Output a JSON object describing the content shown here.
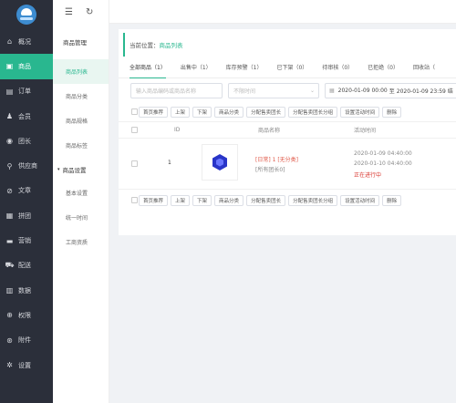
{
  "brand": {
    "logo_text": "魔云"
  },
  "sidebar": {
    "items": [
      {
        "label": "概况",
        "icon": "home-icon",
        "glyph": "⌂"
      },
      {
        "label": "商品",
        "icon": "goods-icon",
        "glyph": "▣",
        "active": true
      },
      {
        "label": "订单",
        "icon": "order-icon",
        "glyph": "▤"
      },
      {
        "label": "会员",
        "icon": "user-icon",
        "glyph": "♟"
      },
      {
        "label": "团长",
        "icon": "leader-icon",
        "glyph": "◉"
      },
      {
        "label": "供应商",
        "icon": "supplier-icon",
        "glyph": "⚲"
      },
      {
        "label": "文章",
        "icon": "article-icon",
        "glyph": "⊘"
      },
      {
        "label": "拼团",
        "icon": "group-icon",
        "glyph": "▦"
      },
      {
        "label": "营销",
        "icon": "marketing-icon",
        "glyph": "▬"
      },
      {
        "label": "配送",
        "icon": "delivery-icon",
        "glyph": "⛟"
      },
      {
        "label": "数据",
        "icon": "data-icon",
        "glyph": "▥"
      },
      {
        "label": "权限",
        "icon": "permission-icon",
        "glyph": "⊕"
      },
      {
        "label": "附件",
        "icon": "attachment-icon",
        "glyph": "⊛"
      },
      {
        "label": "设置",
        "icon": "settings-icon",
        "glyph": "✲"
      }
    ]
  },
  "submenu": {
    "collapse_glyph": "☰",
    "refresh_glyph": "↻",
    "title": "商品管理",
    "items_a": [
      "商品列表",
      "商品分类",
      "商品规格",
      "商品标签"
    ],
    "group_label": "商品设置",
    "group_caret": "▾",
    "items_b": [
      "基本设置",
      "统一时间",
      "工商资质"
    ]
  },
  "main": {
    "breadcrumb_prefix": "当前位置：",
    "breadcrumb_current": "商品列表",
    "tabs": [
      "全部商品（1）",
      "出售中（1）",
      "库存预警（1）",
      "已下架（0）",
      "待审核（0）",
      "已拒绝（0）",
      "回收站（"
    ],
    "search_placeholder": "输入商品编码或商品名称",
    "time_placeholder": "不限时间",
    "time_caret": "⌄",
    "date_icon": "▦",
    "date_start": "2020-01-09 00:00",
    "date_sep": "至",
    "date_end": "2020-01-09 23:59 结",
    "buttons": [
      "首页推荐",
      "上架",
      "下架",
      "商品分类",
      "分配售卖团长",
      "分配售卖团长分组",
      "设置活动时间",
      "删除"
    ],
    "buttons_bottom": [
      "首页推荐",
      "上架",
      "下架",
      "商品分类",
      "分配售卖团长",
      "分配售卖团长分组",
      "设置活动时间",
      "删除"
    ],
    "columns": {
      "id": "ID",
      "name": "商品名称",
      "time": "活动时间"
    },
    "row": {
      "id": "1",
      "name_line1": "[日常] 1 [无分类]",
      "name_line2": "[所有团长0]",
      "time_start": "2020-01-09 04:40:00",
      "time_end": "2020-01-10 04:40:00",
      "status": "正在进行中"
    }
  },
  "colors": {
    "accent": "#29b78f",
    "sidebar_bg": "#2b2f3a",
    "status_red": "#d9332b",
    "tag_red": "#e05a4a"
  }
}
